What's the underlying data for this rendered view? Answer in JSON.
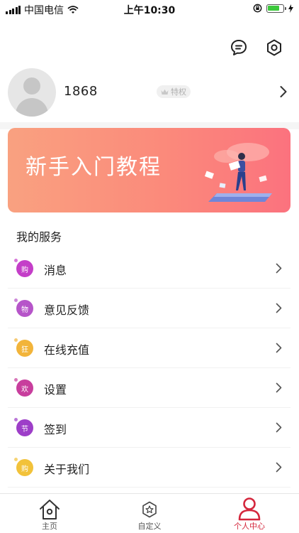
{
  "status_bar": {
    "carrier": "中国电信",
    "time": "上午10:30",
    "battery_level": 0.75
  },
  "header": {
    "icons": [
      "message-icon",
      "settings-icon"
    ]
  },
  "profile": {
    "phone": "1868",
    "badge": "特权"
  },
  "banner": {
    "title": "新手入门教程"
  },
  "services": {
    "title": "我的服务",
    "items": [
      {
        "icon_text": "购",
        "label": "消息",
        "color": "#c43ec8"
      },
      {
        "icon_text": "物",
        "label": "意见反馈",
        "color": "#b655c9"
      },
      {
        "icon_text": "狂",
        "label": "在线充值",
        "color": "#f2b43a"
      },
      {
        "icon_text": "欢",
        "label": "设置",
        "color": "#c83e9d"
      },
      {
        "icon_text": "节",
        "label": "签到",
        "color": "#9d3ec8"
      },
      {
        "icon_text": "购",
        "label": "关于我们",
        "color": "#f2c23a"
      }
    ]
  },
  "tabbar": {
    "tabs": [
      {
        "label": "主页",
        "icon": "home-icon"
      },
      {
        "label": "自定义",
        "icon": "star-hexagon-icon"
      },
      {
        "label": "个人中心",
        "icon": "person-icon",
        "active": true
      }
    ],
    "active_color": "#d4263c"
  }
}
